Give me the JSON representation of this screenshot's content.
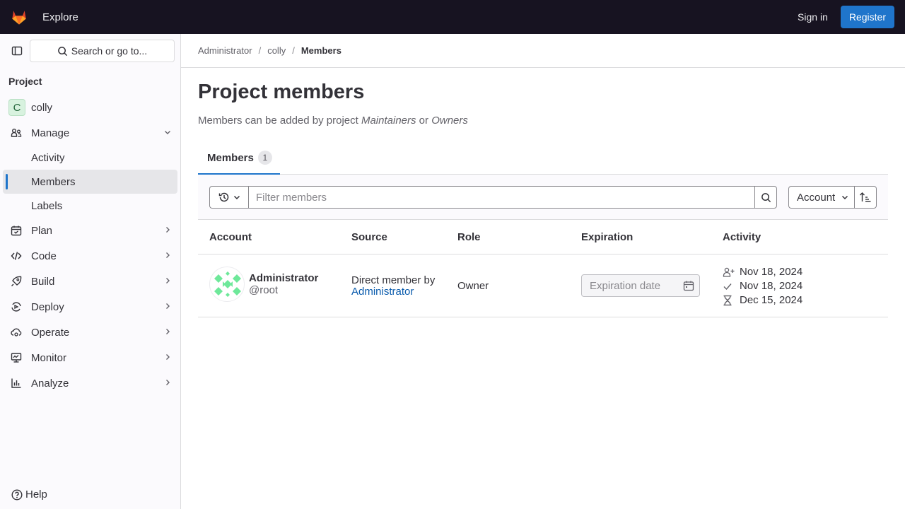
{
  "topbar": {
    "explore": "Explore",
    "sign_in": "Sign in",
    "register": "Register"
  },
  "sidebar": {
    "search_label": "Search or go to...",
    "section": "Project",
    "project_name": "colly",
    "project_initial": "C",
    "manage": "Manage",
    "manage_items": [
      "Activity",
      "Members",
      "Labels"
    ],
    "items": [
      "Plan",
      "Code",
      "Build",
      "Deploy",
      "Operate",
      "Monitor",
      "Analyze"
    ],
    "help": "Help"
  },
  "breadcrumb": [
    "Administrator",
    "colly",
    "Members"
  ],
  "page": {
    "title": "Project members",
    "subtitle_prefix": "Members can be added by project ",
    "subtitle_role1": "Maintainers",
    "subtitle_or": " or ",
    "subtitle_role2": "Owners"
  },
  "tabs": [
    {
      "label": "Members",
      "count": "1"
    }
  ],
  "filter": {
    "placeholder": "Filter members",
    "sort_label": "Account"
  },
  "table": {
    "headers": [
      "Account",
      "Source",
      "Role",
      "Expiration",
      "Activity"
    ],
    "rows": [
      {
        "name": "Administrator",
        "username": "@root",
        "source_line1": "Direct member by",
        "source_link": "Administrator",
        "role": "Owner",
        "expiration_placeholder": "Expiration date",
        "activity": [
          "Nov 18, 2024",
          "Nov 18, 2024",
          "Dec 15, 2024"
        ]
      }
    ]
  },
  "colors": {
    "topbar_bg": "#171321",
    "accent": "#1f75cb",
    "link": "#0b5cad",
    "avatar_identicon": "#6ee89a"
  }
}
